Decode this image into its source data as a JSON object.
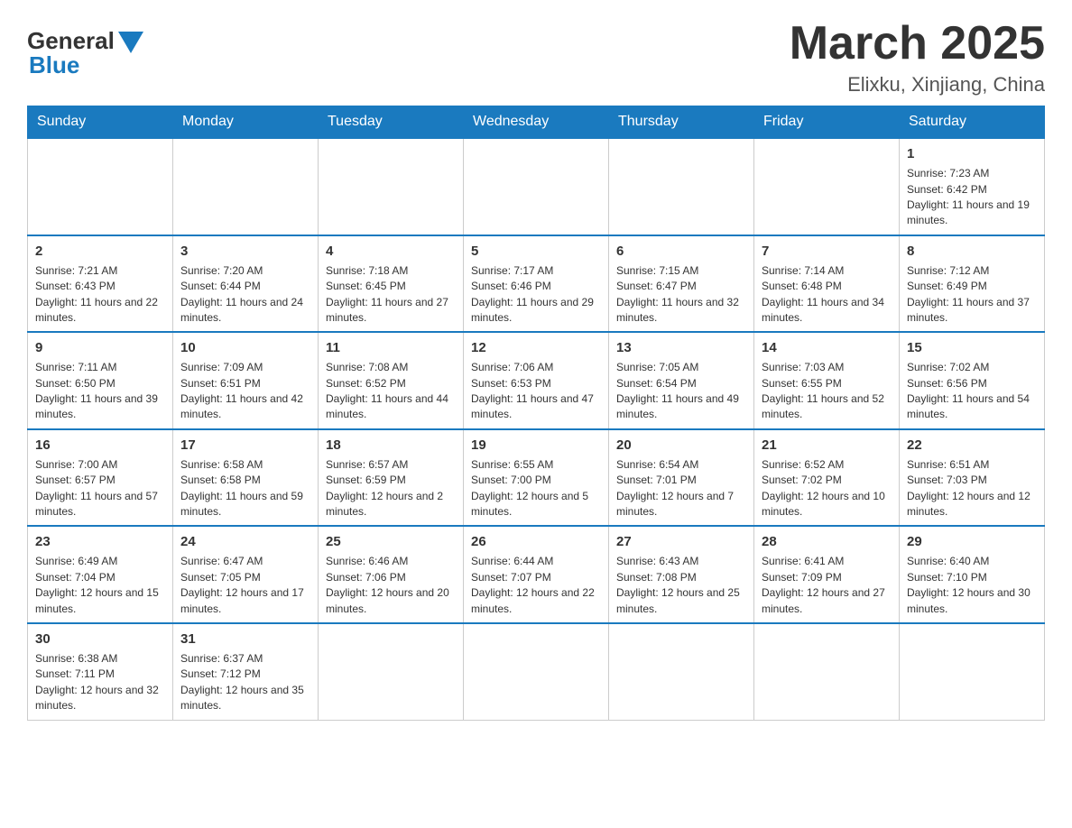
{
  "logo": {
    "general": "General",
    "blue": "Blue"
  },
  "header": {
    "month_year": "March 2025",
    "location": "Elixku, Xinjiang, China"
  },
  "weekdays": [
    "Sunday",
    "Monday",
    "Tuesday",
    "Wednesday",
    "Thursday",
    "Friday",
    "Saturday"
  ],
  "weeks": [
    [
      {
        "day": "",
        "info": ""
      },
      {
        "day": "",
        "info": ""
      },
      {
        "day": "",
        "info": ""
      },
      {
        "day": "",
        "info": ""
      },
      {
        "day": "",
        "info": ""
      },
      {
        "day": "",
        "info": ""
      },
      {
        "day": "1",
        "info": "Sunrise: 7:23 AM\nSunset: 6:42 PM\nDaylight: 11 hours and 19 minutes."
      }
    ],
    [
      {
        "day": "2",
        "info": "Sunrise: 7:21 AM\nSunset: 6:43 PM\nDaylight: 11 hours and 22 minutes."
      },
      {
        "day": "3",
        "info": "Sunrise: 7:20 AM\nSunset: 6:44 PM\nDaylight: 11 hours and 24 minutes."
      },
      {
        "day": "4",
        "info": "Sunrise: 7:18 AM\nSunset: 6:45 PM\nDaylight: 11 hours and 27 minutes."
      },
      {
        "day": "5",
        "info": "Sunrise: 7:17 AM\nSunset: 6:46 PM\nDaylight: 11 hours and 29 minutes."
      },
      {
        "day": "6",
        "info": "Sunrise: 7:15 AM\nSunset: 6:47 PM\nDaylight: 11 hours and 32 minutes."
      },
      {
        "day": "7",
        "info": "Sunrise: 7:14 AM\nSunset: 6:48 PM\nDaylight: 11 hours and 34 minutes."
      },
      {
        "day": "8",
        "info": "Sunrise: 7:12 AM\nSunset: 6:49 PM\nDaylight: 11 hours and 37 minutes."
      }
    ],
    [
      {
        "day": "9",
        "info": "Sunrise: 7:11 AM\nSunset: 6:50 PM\nDaylight: 11 hours and 39 minutes."
      },
      {
        "day": "10",
        "info": "Sunrise: 7:09 AM\nSunset: 6:51 PM\nDaylight: 11 hours and 42 minutes."
      },
      {
        "day": "11",
        "info": "Sunrise: 7:08 AM\nSunset: 6:52 PM\nDaylight: 11 hours and 44 minutes."
      },
      {
        "day": "12",
        "info": "Sunrise: 7:06 AM\nSunset: 6:53 PM\nDaylight: 11 hours and 47 minutes."
      },
      {
        "day": "13",
        "info": "Sunrise: 7:05 AM\nSunset: 6:54 PM\nDaylight: 11 hours and 49 minutes."
      },
      {
        "day": "14",
        "info": "Sunrise: 7:03 AM\nSunset: 6:55 PM\nDaylight: 11 hours and 52 minutes."
      },
      {
        "day": "15",
        "info": "Sunrise: 7:02 AM\nSunset: 6:56 PM\nDaylight: 11 hours and 54 minutes."
      }
    ],
    [
      {
        "day": "16",
        "info": "Sunrise: 7:00 AM\nSunset: 6:57 PM\nDaylight: 11 hours and 57 minutes."
      },
      {
        "day": "17",
        "info": "Sunrise: 6:58 AM\nSunset: 6:58 PM\nDaylight: 11 hours and 59 minutes."
      },
      {
        "day": "18",
        "info": "Sunrise: 6:57 AM\nSunset: 6:59 PM\nDaylight: 12 hours and 2 minutes."
      },
      {
        "day": "19",
        "info": "Sunrise: 6:55 AM\nSunset: 7:00 PM\nDaylight: 12 hours and 5 minutes."
      },
      {
        "day": "20",
        "info": "Sunrise: 6:54 AM\nSunset: 7:01 PM\nDaylight: 12 hours and 7 minutes."
      },
      {
        "day": "21",
        "info": "Sunrise: 6:52 AM\nSunset: 7:02 PM\nDaylight: 12 hours and 10 minutes."
      },
      {
        "day": "22",
        "info": "Sunrise: 6:51 AM\nSunset: 7:03 PM\nDaylight: 12 hours and 12 minutes."
      }
    ],
    [
      {
        "day": "23",
        "info": "Sunrise: 6:49 AM\nSunset: 7:04 PM\nDaylight: 12 hours and 15 minutes."
      },
      {
        "day": "24",
        "info": "Sunrise: 6:47 AM\nSunset: 7:05 PM\nDaylight: 12 hours and 17 minutes."
      },
      {
        "day": "25",
        "info": "Sunrise: 6:46 AM\nSunset: 7:06 PM\nDaylight: 12 hours and 20 minutes."
      },
      {
        "day": "26",
        "info": "Sunrise: 6:44 AM\nSunset: 7:07 PM\nDaylight: 12 hours and 22 minutes."
      },
      {
        "day": "27",
        "info": "Sunrise: 6:43 AM\nSunset: 7:08 PM\nDaylight: 12 hours and 25 minutes."
      },
      {
        "day": "28",
        "info": "Sunrise: 6:41 AM\nSunset: 7:09 PM\nDaylight: 12 hours and 27 minutes."
      },
      {
        "day": "29",
        "info": "Sunrise: 6:40 AM\nSunset: 7:10 PM\nDaylight: 12 hours and 30 minutes."
      }
    ],
    [
      {
        "day": "30",
        "info": "Sunrise: 6:38 AM\nSunset: 7:11 PM\nDaylight: 12 hours and 32 minutes."
      },
      {
        "day": "31",
        "info": "Sunrise: 6:37 AM\nSunset: 7:12 PM\nDaylight: 12 hours and 35 minutes."
      },
      {
        "day": "",
        "info": ""
      },
      {
        "day": "",
        "info": ""
      },
      {
        "day": "",
        "info": ""
      },
      {
        "day": "",
        "info": ""
      },
      {
        "day": "",
        "info": ""
      }
    ]
  ]
}
